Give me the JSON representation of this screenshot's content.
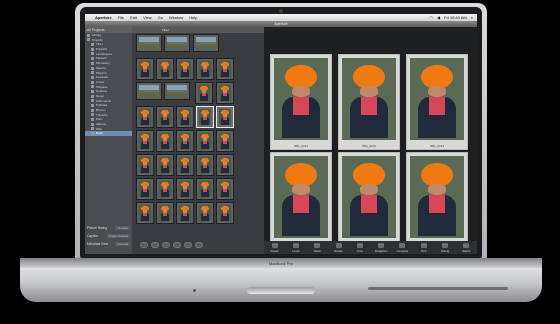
{
  "laptop": {
    "brand_label": "MacBook Pro"
  },
  "menubar": {
    "app_name": "Aperture",
    "items": [
      "File",
      "Edit",
      "View",
      "Go",
      "Window",
      "Help"
    ],
    "clock": "Fri 10:40 AM"
  },
  "window_title": "Aperture",
  "projects": {
    "header": "All Projects",
    "items": [
      "Library",
      "Projects",
      "Tibet",
      "Portraits",
      "Landscapes",
      "Markets",
      "Monastery",
      "Selects",
      "Pilgrims",
      "Festivals",
      "Lhasa",
      "Shigatse",
      "Gyantse",
      "Nepal",
      "Kathmandu",
      "Pokhara",
      "Bhutan",
      "Thimphu",
      "Paro",
      "Albums",
      "Web",
      "Book"
    ],
    "selected_index": 21
  },
  "metadata": {
    "lbl1": "Picture Rating",
    "val1": "Unrated",
    "lbl2": "Caption",
    "val2": "Prayer festival",
    "lbl3": "Metadata View",
    "val3": "General"
  },
  "browser": {
    "toolbar_label": "Tibet"
  },
  "viewer": {
    "captions": [
      "IMG_0211",
      "IMG_0212",
      "IMG_0213",
      "IMG_0214",
      "IMG_0215",
      "IMG_0216"
    ]
  },
  "viewer_tools": [
    "Viewer",
    "Loupe",
    "Stack",
    "Rotate",
    "Crop",
    "Straighten",
    "Compare",
    "Pick",
    "Rating",
    "Stamp"
  ]
}
